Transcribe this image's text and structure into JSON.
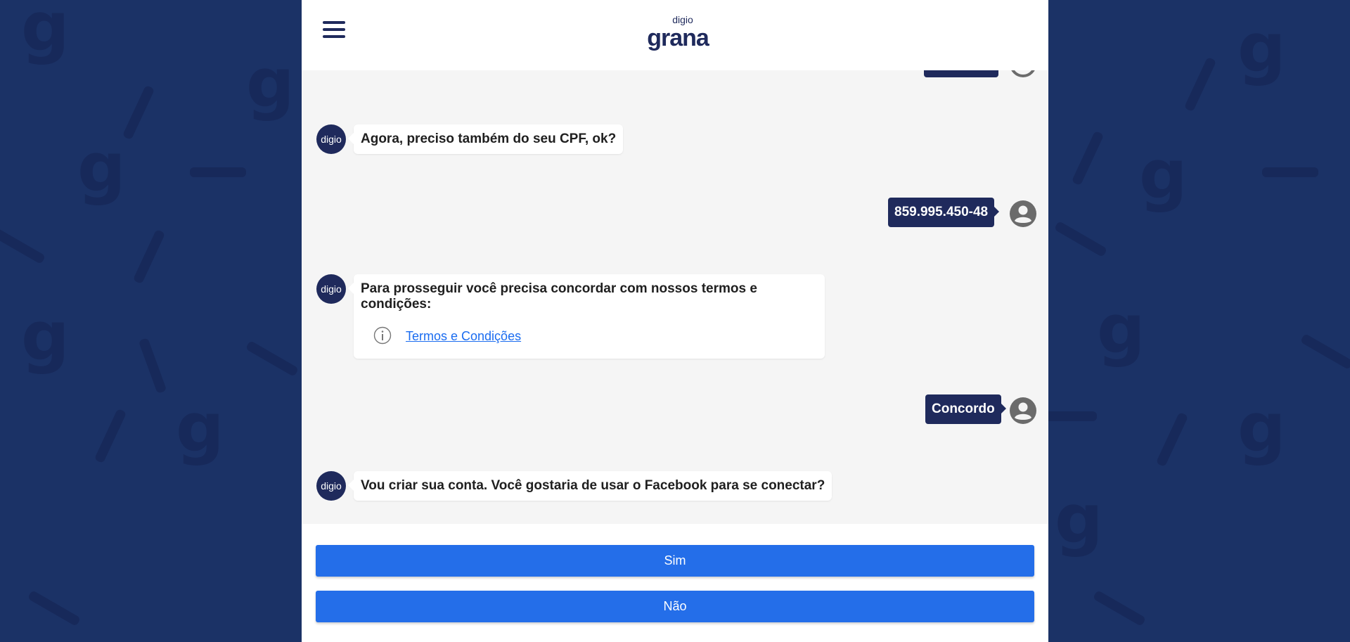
{
  "header": {
    "menu_icon": "hamburger-menu-icon",
    "logo_small": "digio",
    "logo_big": "grana"
  },
  "messages": [
    {
      "from": "bot",
      "avatar_label": "digio",
      "text": "Agora, preciso também do seu CPF, ok?"
    },
    {
      "from": "user",
      "text": "859.995.450-48"
    },
    {
      "from": "bot",
      "avatar_label": "digio",
      "text": "Para prosseguir você precisa concordar com nossos termos e condições:",
      "link": "Termos e Condições"
    },
    {
      "from": "user",
      "text": "Concordo"
    },
    {
      "from": "bot",
      "avatar_label": "digio",
      "text": "Vou criar sua conta. Você gostaria de usar o Facebook para se conectar?"
    }
  ],
  "actions": {
    "yes_label": "Sim",
    "no_label": "Não"
  },
  "colors": {
    "page_background": "#1b3266",
    "brand_navy": "#1f2a5c",
    "button_blue": "#246ee9",
    "link_blue": "#1a6cf0"
  }
}
